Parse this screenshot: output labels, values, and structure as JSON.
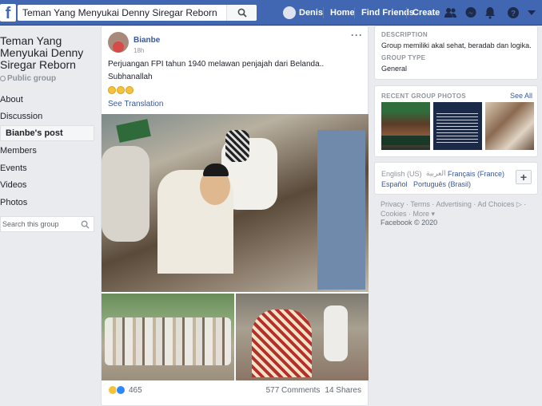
{
  "topbar": {
    "logo": "f",
    "search_value": "Teman Yang Menyukai Denny Siregar Reborn",
    "user_name": "Denis",
    "home": "Home",
    "find_friends": "Find Friends",
    "create": "Create"
  },
  "left": {
    "group_title": "Teman Yang Menyukai Denny Siregar Reborn",
    "privacy": "Public group",
    "nav": [
      "About",
      "Discussion",
      "Bianbe's post",
      "Members",
      "Events",
      "Videos",
      "Photos"
    ],
    "search_placeholder": "Search this group"
  },
  "post": {
    "author": "Bianbe",
    "time": "18h",
    "line1": "Perjuangan FPI tahun 1940 melawan penjajah dari Belanda..",
    "line2": "Subhanallah",
    "see_translation": "See Translation",
    "more": "···",
    "reaction_count": "465",
    "comments": "577 Comments",
    "shares": "14 Shares"
  },
  "right": {
    "description_label": "DESCRIPTION",
    "description": "Group memiliki akal sehat, beradab dan logika.",
    "group_type_label": "GROUP TYPE",
    "group_type": "General",
    "photos_label": "RECENT GROUP PHOTOS",
    "see_all": "See All",
    "languages": {
      "current": "English (US)",
      "arabic": "العربية",
      "french": "Français (France)",
      "spanish": "Español",
      "portuguese": "Português (Brasil)"
    },
    "footer_line1": "Privacy · Terms · Advertising · Ad Choices ▷ ·",
    "footer_line2": "Cookies · More ▾",
    "footer_line3": "Facebook © 2020"
  },
  "colors": {
    "brand": "#4267b2",
    "link": "#385898",
    "like": "#2d88ff",
    "haha": "#f7c23b"
  }
}
